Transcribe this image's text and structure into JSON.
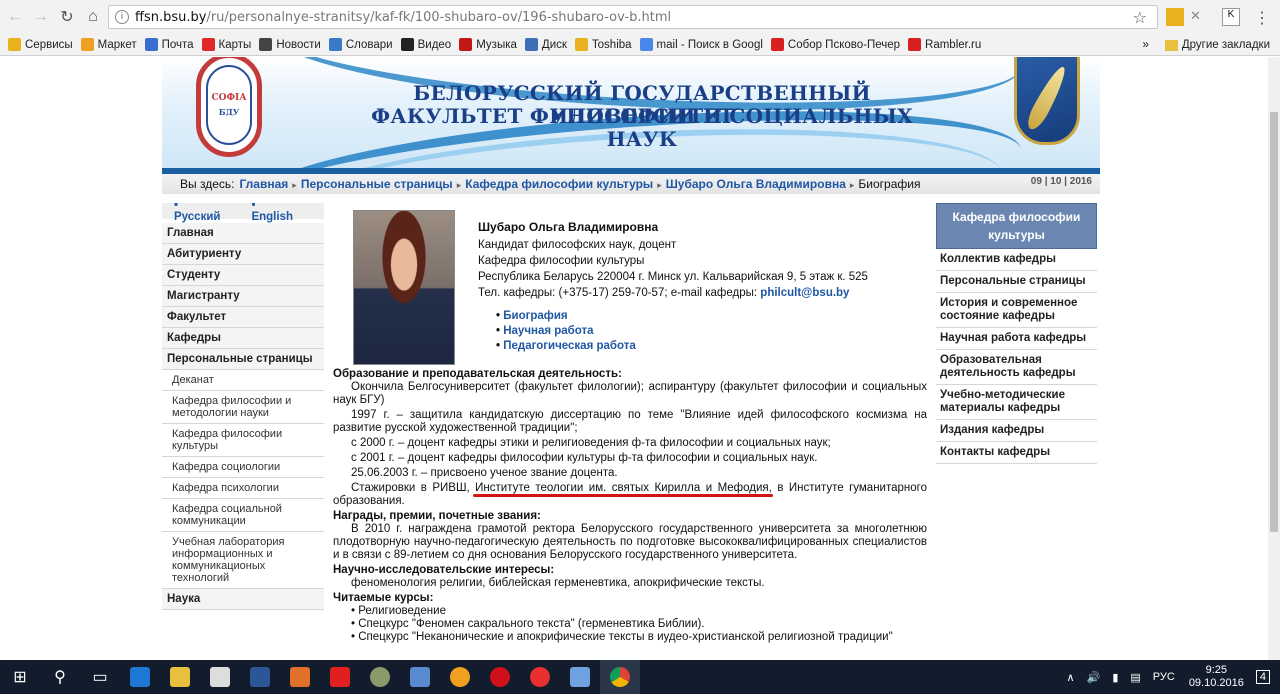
{
  "browser": {
    "url_host": "ffsn.bsu.by",
    "url_path": "/ru/personalnye-stranitsy/kaf-fk/100-shubaro-ov/196-shubaro-ov-b.html",
    "bookmarks": [
      {
        "label": "Сервисы",
        "color": "#e8b11d"
      },
      {
        "label": "Маркет",
        "color": "#f0a020"
      },
      {
        "label": "Почта",
        "color": "#3a6fd0"
      },
      {
        "label": "Карты",
        "color": "#e02828"
      },
      {
        "label": "Новости",
        "color": "#444"
      },
      {
        "label": "Словари",
        "color": "#3a78c8"
      },
      {
        "label": "Видео",
        "color": "#222"
      },
      {
        "label": "Музыка",
        "color": "#c01818"
      },
      {
        "label": "Диск",
        "color": "#3f6fb5"
      },
      {
        "label": "Toshiba",
        "color": "#e8b11d"
      },
      {
        "label": "mail - Поиск в Googl",
        "color": "#4a87e8"
      },
      {
        "label": "Собор Псково-Печер",
        "color": "#d82020"
      },
      {
        "label": "Rambler.ru",
        "color": "#d82020"
      }
    ],
    "more_chevron": "»",
    "other_bookmarks": "Другие закладки"
  },
  "header": {
    "title_line1": "БЕЛОРУССКИЙ ГОСУДАРСТВЕННЫЙ УНИВЕРСИТЕТ",
    "title_line2": "ФАКУЛЬТЕТ ФИЛОСОФИИ И СОЦИАЛЬНЫХ НАУК",
    "seal_text1": "СОФІА",
    "seal_text2": "БДУ"
  },
  "breadcrumb": {
    "prefix": "Вы здесь:",
    "items": [
      "Главная",
      "Персональные страницы",
      "Кафедра философии культуры",
      "Шубаро Ольга Владимировна"
    ],
    "current": "Биография",
    "date": "09 | 10 | 2016"
  },
  "lang": {
    "ru": "Русский",
    "en": "English"
  },
  "left_nav": [
    {
      "label": "Главная",
      "sub": false
    },
    {
      "label": "Абитуриенту",
      "sub": false
    },
    {
      "label": "Студенту",
      "sub": false
    },
    {
      "label": "Магистранту",
      "sub": false
    },
    {
      "label": "Факультет",
      "sub": false
    },
    {
      "label": "Кафедры",
      "sub": false
    },
    {
      "label": "Персональные страницы",
      "sub": false
    },
    {
      "label": "Деканат",
      "sub": true
    },
    {
      "label": "Кафедра философии и методологии науки",
      "sub": true
    },
    {
      "label": "Кафедра философии культуры",
      "sub": true
    },
    {
      "label": "Кафедра социологии",
      "sub": true
    },
    {
      "label": "Кафедра психологии",
      "sub": true
    },
    {
      "label": "Кафедра социальной коммуникации",
      "sub": true
    },
    {
      "label": "Учебная лаборатория информационных и коммуникационых технологий",
      "sub": true
    },
    {
      "label": "Наука",
      "sub": false
    }
  ],
  "right_nav": {
    "heading": "Кафедра философии культуры",
    "items": [
      "Коллектив кафедры",
      "Персональные страницы",
      "История и современное состояние кафедры",
      "Научная работа кафедры",
      "Образовательная деятельность кафедры",
      "Учебно-методические материалы кафедры",
      "Издания кафедры",
      "Контакты кафедры"
    ]
  },
  "profile": {
    "name": "Шубаро Ольга Владимировна",
    "degree": "Кандидат философских наук, доцент",
    "department": "Кафедра философии культуры",
    "address": "Республика Беларусь 220004 г. Минск ул. Кальварийская 9, 5 этаж к. 525",
    "phone_prefix": "Тел. кафедры: (+375-17) 259-70-57; e-mail кафедры: ",
    "email": "philcult@bsu.by",
    "links": [
      "Биография",
      "Научная работа",
      "Педагогическая работа"
    ]
  },
  "content": {
    "h_education": "Образование и преподавательская деятельность:",
    "p1": "Окончила Белгосуниверситет (факультет филологии); аспирантуру (факультет философии и социальных наук БГУ)",
    "p2": "1997 г. – защитила кандидатскую диссертацию по теме \"Влияние идей философского космизма на развитие русской художественной традиции\";",
    "p3": "с 2000 г. – доцент кафедры этики и религиоведения ф-та философии и социальных наук;",
    "p4": "с 2001 г. – доцент кафедры философии культуры ф-та философии и социальных наук.",
    "p5": "25.06.2003 г. – присвоено ученое звание доцента.",
    "p6": "Стажировки в РИВШ, Институте теологии им. святых Кирилла и Мефодия, в Институте гуманитарного образования.",
    "h_awards": "Награды, премии, почетные звания:",
    "p7": "В 2010 г. награждена грамотой ректора Белорусского государственного университета за многолетнюю плодотворную научно-педагогическую деятельность по подготовке высококвалифицированных специалистов и в связи с 89-летием со дня основания Белорусского государственного университета.",
    "h_interests": "Научно-исследовательские интересы:",
    "p8": "феноменология религии, библейская герменевтика, апокрифические тексты.",
    "h_courses": "Читаемые курсы:",
    "courses": [
      "Религиоведение",
      "Спецкурс \"Феномен сакрального текста\" (герменевтика Библии).",
      "Спецкурс \"Неканонические  и апокрифические тексты в иудео-христианской религиозной  традиции\""
    ]
  },
  "taskbar": {
    "lang": "РУС",
    "time": "9:25",
    "date": "09.10.2016",
    "notifications": "4"
  }
}
